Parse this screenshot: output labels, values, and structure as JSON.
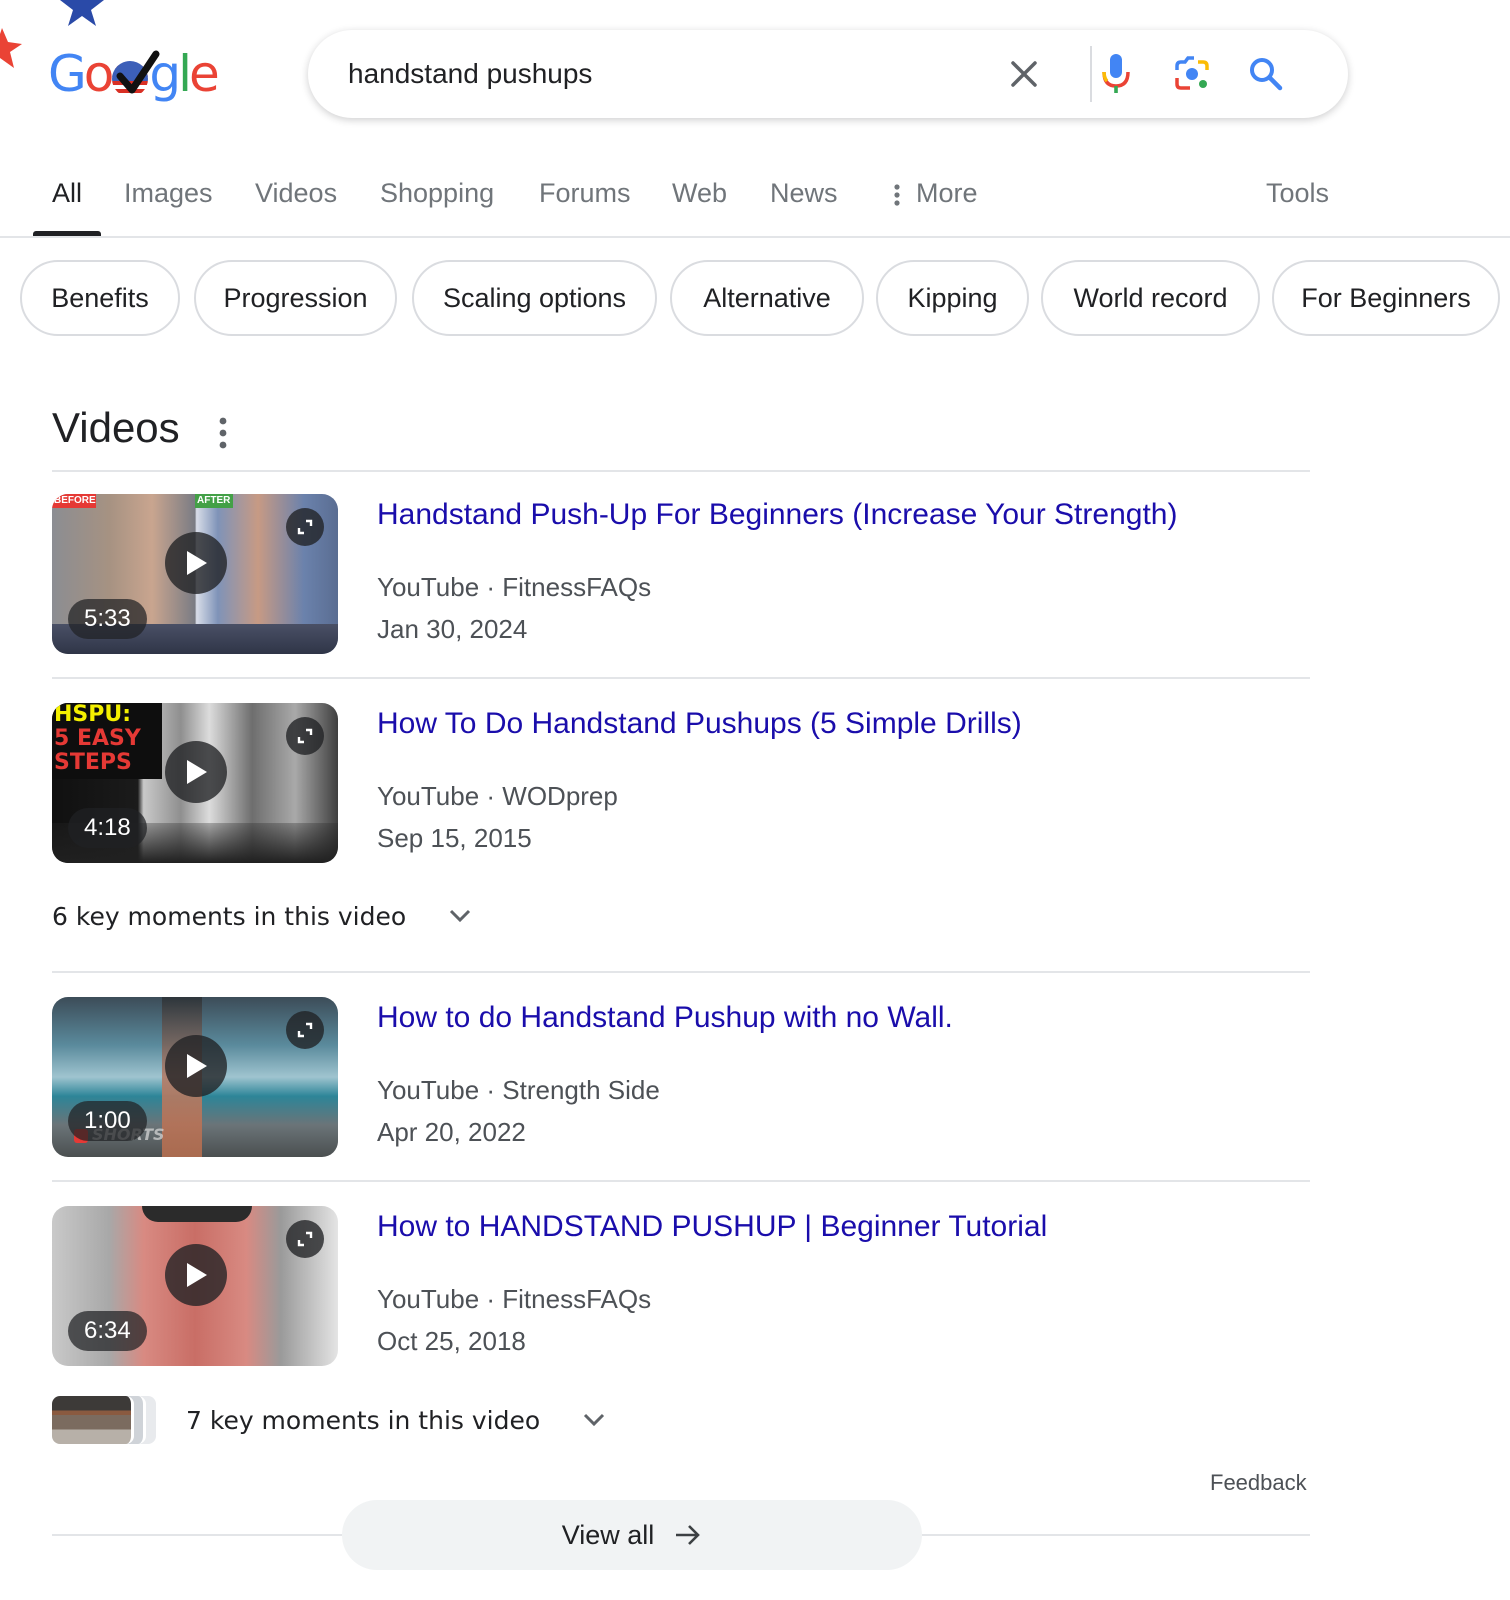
{
  "header": {
    "logo_text": "Google",
    "search": {
      "value": "handstand pushups",
      "clear_icon": "close-icon",
      "voice_icon": "microphone-icon",
      "lens_icon": "camera-lens-icon",
      "search_icon": "search-icon"
    }
  },
  "tabs": [
    {
      "label": "All",
      "active": true
    },
    {
      "label": "Images"
    },
    {
      "label": "Videos"
    },
    {
      "label": "Shopping"
    },
    {
      "label": "Forums"
    },
    {
      "label": "Web"
    },
    {
      "label": "News"
    },
    {
      "label": "More",
      "icon": "more-vert-icon"
    }
  ],
  "tools_label": "Tools",
  "chips": [
    "Benefits",
    "Progression",
    "Scaling options",
    "Alternative",
    "Kipping",
    "World record",
    "For Beginners"
  ],
  "videos_section": {
    "title": "Videos",
    "menu_icon": "more-vert-icon",
    "items": [
      {
        "title": "Handstand Push-Up For Beginners (Increase Your Strength)",
        "source": "YouTube · FitnessFAQs",
        "date": "Jan 30, 2024",
        "duration": "5:33",
        "thumb_labels": [
          "BEFORE",
          "AFTER"
        ]
      },
      {
        "title": "How To Do Handstand Pushups (5 Simple Drills)",
        "source": "YouTube · WODprep",
        "date": "Sep 15, 2015",
        "duration": "4:18",
        "thumb_text": [
          "HSPU:",
          "5 EASY",
          "STEPS"
        ],
        "key_moments": "6 key moments in this video"
      },
      {
        "title": "How to do Handstand Pushup with no Wall.",
        "source": "YouTube · Strength Side",
        "date": "Apr 20, 2022",
        "duration": "1:00",
        "thumb_badge": "SHORTS"
      },
      {
        "title": "How to HANDSTAND PUSHUP | Beginner Tutorial",
        "source": "YouTube · FitnessFAQs",
        "date": "Oct 25, 2018",
        "duration": "6:34",
        "key_moments": "7 key moments in this video"
      }
    ],
    "feedback_label": "Feedback",
    "view_all_label": "View all"
  },
  "colors": {
    "link": "#1a0dab",
    "muted": "#70757a",
    "google_blue": "#4285f4",
    "google_red": "#ea4335",
    "google_yellow": "#fbbc05",
    "google_green": "#34a853"
  }
}
